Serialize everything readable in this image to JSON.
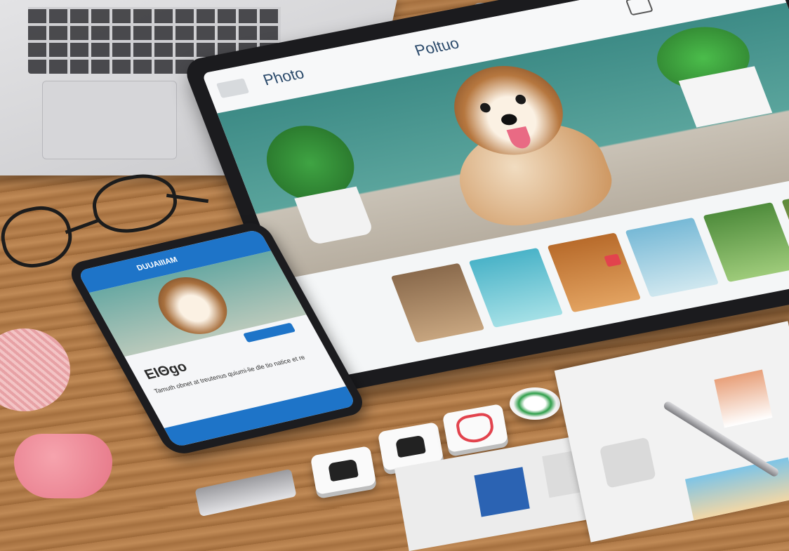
{
  "tablet": {
    "header_left": "Photo",
    "header_center": "Poltuo",
    "accent": "#2a7bbf"
  },
  "phone": {
    "header": "DUUAIIIAM",
    "title": "ΕΙΘgo",
    "body_text": "Tamuth obnet at treutenus quiumi-lie dle tio natice et re",
    "accent": "#1e74c8"
  },
  "colors": {
    "wood": "#b07a48",
    "heart_red": "#e2434d",
    "teal_wall": "#3d8b86"
  },
  "icons": [
    "heart-icon",
    "like-icon",
    "facebook-icon",
    "camera-icon"
  ]
}
